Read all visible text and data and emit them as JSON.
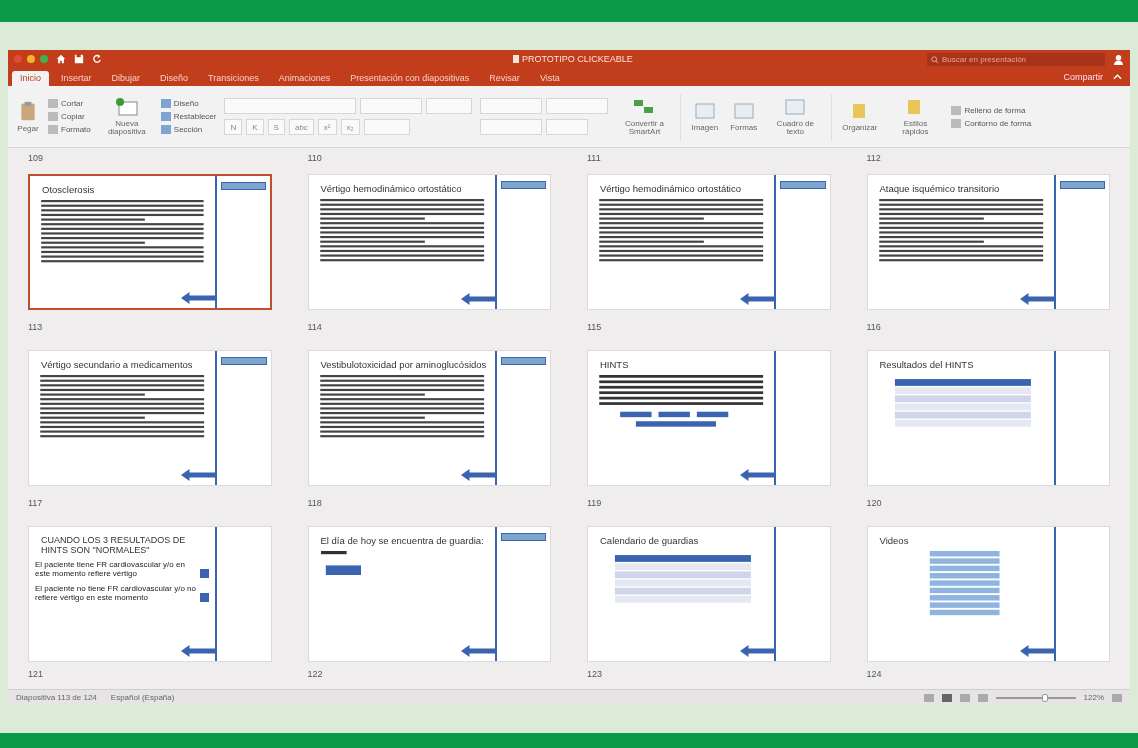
{
  "window": {
    "title": "PROTOTIPO CLICKEABLE",
    "search": {
      "placeholder": "Buscar en presentación"
    }
  },
  "tabs": [
    {
      "label": "Inicio",
      "selected": true
    },
    {
      "label": "Insertar",
      "selected": false
    },
    {
      "label": "Dibujar",
      "selected": false
    },
    {
      "label": "Diseño",
      "selected": false
    },
    {
      "label": "Transiciones",
      "selected": false
    },
    {
      "label": "Animaciones",
      "selected": false
    },
    {
      "label": "Presentación con diapositivas",
      "selected": false
    },
    {
      "label": "Revisar",
      "selected": false
    },
    {
      "label": "Vista",
      "selected": false
    }
  ],
  "share": "Compartir",
  "ribbon": {
    "paste": "Pegar",
    "clipboard": [
      "Cortar",
      "Copiar",
      "Formato"
    ],
    "new_slide": "Nueva diapositiva",
    "slide_items": [
      "Diseño",
      "Restablecer",
      "Sección"
    ],
    "format_buttons": [
      "N",
      "K",
      "S",
      "abc",
      "x²",
      "x₂"
    ],
    "smartart": "Convertir a SmartArt",
    "insert": [
      "Imagen",
      "Formas",
      "Cuadro de texto"
    ],
    "arrange": [
      "Organizar",
      "Estilos rápidos"
    ],
    "shape_items": [
      "Relleno de forma",
      "Contorno de forma"
    ]
  },
  "top_labels": [
    "109",
    "110",
    "111",
    "112"
  ],
  "slides": [
    {
      "number": "113",
      "title": "Otosclerosis",
      "selected": true,
      "kind": "text",
      "side_button": true,
      "back_arrow": true
    },
    {
      "number": "114",
      "title": "Vértigo hemodinámico ortostático",
      "selected": false,
      "kind": "text",
      "side_button": true,
      "back_arrow": true
    },
    {
      "number": "115",
      "title": "Vértigo hemodinámico ortostático",
      "selected": false,
      "kind": "text",
      "side_button": true,
      "back_arrow": true
    },
    {
      "number": "116",
      "title": "Ataque isquémico transitorio",
      "selected": false,
      "kind": "text",
      "side_button": true,
      "back_arrow": true
    },
    {
      "number": "117",
      "title": "Vértigo secundario a medicamentos",
      "selected": false,
      "kind": "text",
      "side_button": true,
      "back_arrow": true
    },
    {
      "number": "118",
      "title": "Vestibulotoxicidad por aminoglucósidos",
      "selected": false,
      "kind": "text",
      "side_button": true,
      "back_arrow": true
    },
    {
      "number": "119",
      "title": "HINTS",
      "selected": false,
      "kind": "buttons",
      "side_button": false,
      "back_arrow": true
    },
    {
      "number": "120",
      "title": "Resultados del HINTS",
      "selected": false,
      "kind": "table",
      "side_button": false,
      "back_arrow": false
    },
    {
      "number": "121",
      "title": "CUANDO LOS 3 RESULTADOS DE HINTS SON \"NORMALES\"",
      "selected": false,
      "kind": "choices",
      "side_button": false,
      "back_arrow": true,
      "items": [
        "El paciente tiene FR cardiovascular y/o en este momento refiere vértigo",
        "El paciente no tiene FR cardiovascular y/o no refiere vértigo en este momento"
      ]
    },
    {
      "number": "122",
      "title": "El día de hoy se encuentra de guardia:",
      "selected": false,
      "kind": "single",
      "side_button": true,
      "back_arrow": true
    },
    {
      "number": "123",
      "title": "Calendario de guardias",
      "selected": false,
      "kind": "table",
      "side_button": false,
      "back_arrow": true
    },
    {
      "number": "124",
      "title": "Videos",
      "selected": false,
      "kind": "list",
      "side_button": false,
      "back_arrow": true
    }
  ],
  "status_bar": {
    "slide": "Diapositiva 113 de 124",
    "language": "Español (España)",
    "zoom": "122%",
    "zoom_slider": {
      "level": 0.62
    }
  }
}
